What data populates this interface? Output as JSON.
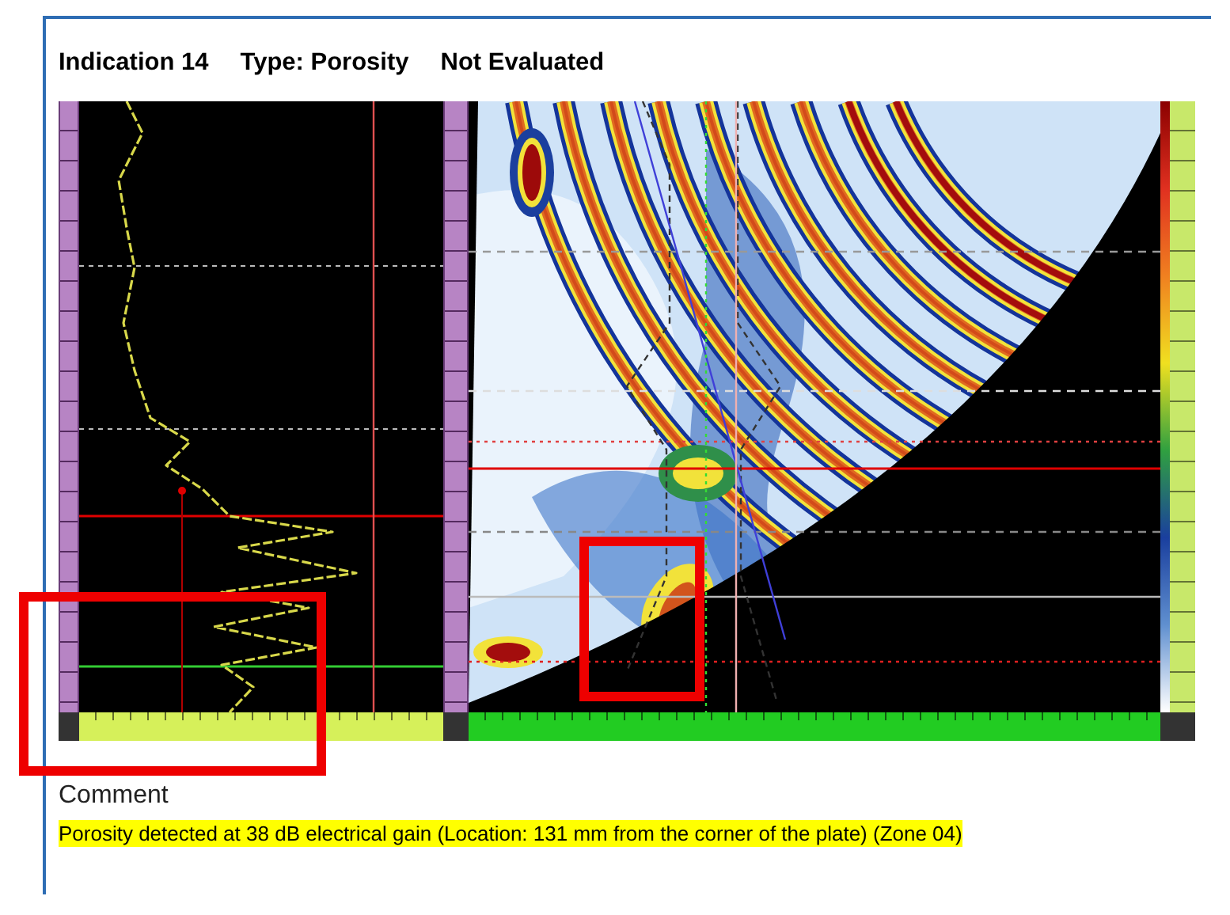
{
  "header": {
    "indication": "Indication 14",
    "type": "Type: Porosity",
    "status": "Not Evaluated"
  },
  "comment": {
    "heading": "Comment",
    "text": "Porosity detected at 38 dB electrical gain (Location: 131 mm from the corner of the plate) (Zone 04)",
    "highlighted": true
  }
}
